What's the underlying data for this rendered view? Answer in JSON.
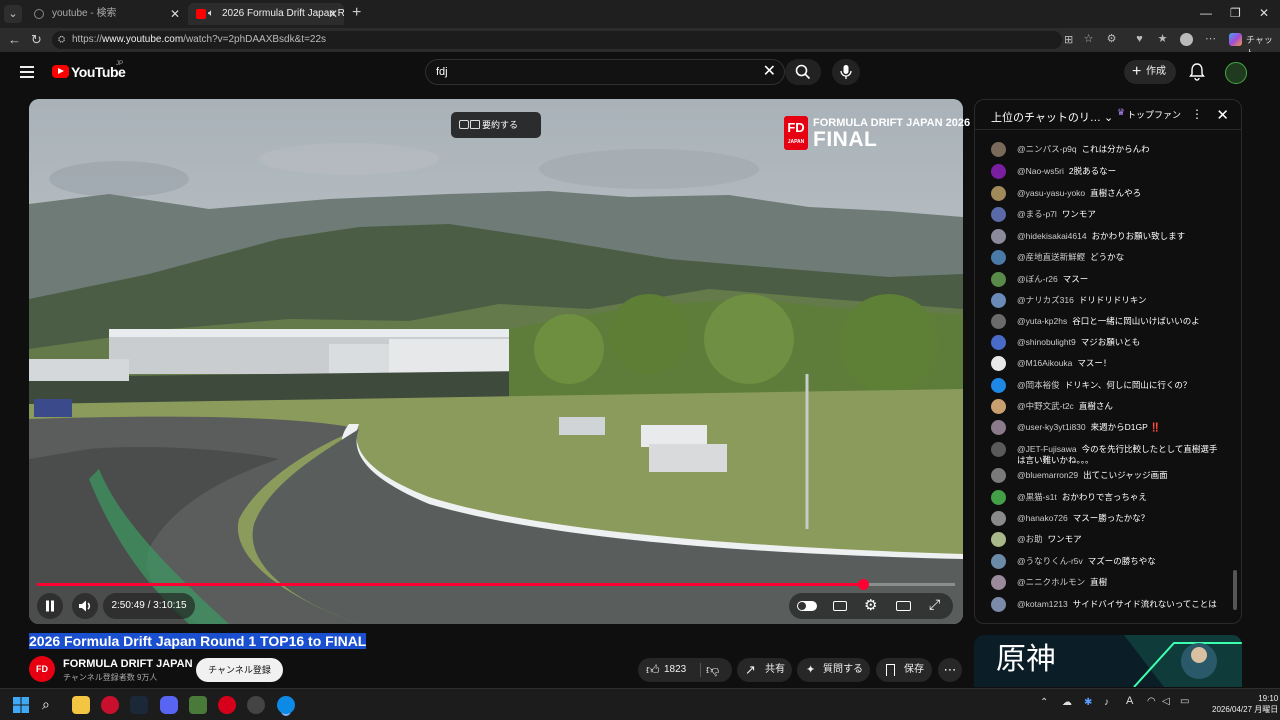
{
  "browser": {
    "tabs": [
      {
        "label": "youtube - 検索",
        "active": false
      },
      {
        "label": "2026 Formula Drift Japan Rou…",
        "active": true
      }
    ],
    "url_prefix": "https://",
    "url_host": "www.youtube.com",
    "url_path": "/watch?v=2phDAAXBsdk&t=22s",
    "copilot_label": "チャット"
  },
  "youtube": {
    "logo_text": "YouTube",
    "logo_region": "JP",
    "search_value": "fdj",
    "create_label": "作成"
  },
  "video": {
    "summary_label": "要約する",
    "overlay_title": "FORMULA DRIFT JAPAN 2026",
    "overlay_final": "FINAL",
    "logo_text": "FD",
    "logo_sub": "JAPAN",
    "time_current": "2:50:49",
    "time_separator": " / ",
    "time_total": "3:10:15",
    "progress_fraction": 0.9
  },
  "info": {
    "title": "2026 Formula Drift Japan Round 1 TOP16 to FINAL",
    "channel_name": "FORMULA DRIFT JAPAN",
    "channel_subs": "チャンネル登録者数 9万人",
    "subscribe_label": "チャンネル登録",
    "like_count": "1823",
    "share_label": "共有",
    "ask_label": "質問する",
    "save_label": "保存"
  },
  "chat": {
    "title": "上位のチャットのリ…",
    "topfan_label": "トップファン",
    "messages": [
      {
        "author": "@ニンパス-p9q",
        "text": "これは分からんわ",
        "color": "#7a6a5a"
      },
      {
        "author": "@Nao-ws5ri",
        "text": "2脱あるなー",
        "color": "#7b1fa2"
      },
      {
        "author": "@yasu-yasu-yoko",
        "text": "直樹さんやろ",
        "color": "#a08a5a"
      },
      {
        "author": "@まる-p7l",
        "text": "ワンモア",
        "color": "#5a6aa8"
      },
      {
        "author": "@hidekisakai4614",
        "text": "おかわりお願い致します",
        "color": "#8a8a9a"
      },
      {
        "author": "@産地直送新鮮鰹",
        "text": "どうかな",
        "color": "#4a7aa8"
      },
      {
        "author": "@ぼん-r26",
        "text": "マスー",
        "color": "#5a8a4a"
      },
      {
        "author": "@ナリカズ316",
        "text": "ドリドリドリキン",
        "color": "#6a8ab8"
      },
      {
        "author": "@yuta-kp2hs",
        "text": "谷口と一緒に岡山いけばいいのよ",
        "color": "#6a6a6a"
      },
      {
        "author": "@shinobulight9",
        "text": "マジお願いとも",
        "color": "#4a6ac8"
      },
      {
        "author": "@M16Aikouka",
        "text": "マスー！",
        "color": "#e8e8e8"
      },
      {
        "author": "@岡本裕俊",
        "text": "ドリキン、何しに岡山に行くの？",
        "color": "#1e88e5"
      },
      {
        "author": "@中野文武-t2c",
        "text": "直樹さん",
        "color": "#c8a070"
      },
      {
        "author": "@user-ky3yt1i830",
        "text": "来週からD1GP ‼️",
        "color": "#8a7a8a"
      },
      {
        "author": "@JET-Fujisawa",
        "text": "今のを先行比較したとして直樹選手は言い難いかね。。。",
        "color": "#5a5a5a"
      },
      {
        "author": "@bluemarron29",
        "text": "出てこいジャッジ画面",
        "color": "#7a7a7a"
      },
      {
        "author": "@黒猫-s1t",
        "text": "おかわりで言っちゃえ",
        "color": "#43a047"
      },
      {
        "author": "@hanako726",
        "text": "マスー勝ったかな？",
        "color": "#8a8a8a"
      },
      {
        "author": "@お助",
        "text": "ワンモア",
        "color": "#a8b888"
      },
      {
        "author": "@うなりくん-r5v",
        "text": "マズーの勝ちやな",
        "color": "#6a8aa8"
      },
      {
        "author": "@ニニクホルモン",
        "text": "直樹",
        "color": "#9a8a9a"
      },
      {
        "author": "@kotam1213",
        "text": "サイドバイサイド流れないってことは",
        "color": "#7a8aa8"
      }
    ]
  },
  "ad": {
    "title": "原神"
  },
  "taskbar": {
    "time": "19:10",
    "date": "2026/04/27 月曜日",
    "ime": "A"
  }
}
